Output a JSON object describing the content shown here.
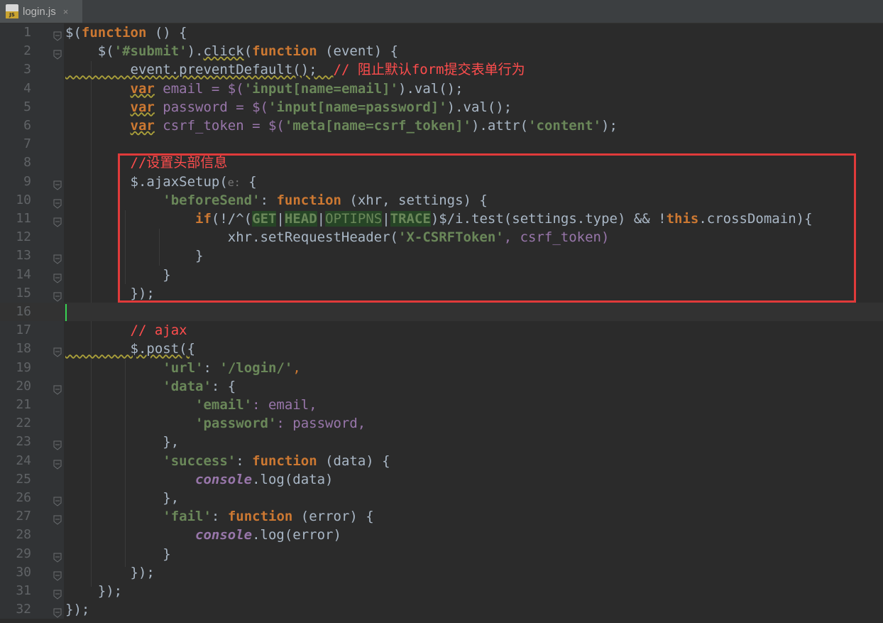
{
  "tab": {
    "filename": "login.js",
    "file_icon": "js-file-icon",
    "close_glyph": "×"
  },
  "line_numbers": [
    "1",
    "2",
    "3",
    "4",
    "5",
    "6",
    "7",
    "8",
    "9",
    "10",
    "11",
    "12",
    "13",
    "14",
    "15",
    "16",
    "17",
    "18",
    "19",
    "20",
    "21",
    "22",
    "23",
    "24",
    "25",
    "26",
    "27",
    "28",
    "29",
    "30",
    "31",
    "32"
  ],
  "lines": {
    "l1": {
      "a": "$(",
      "b": "function",
      "c": " () {"
    },
    "l2": {
      "a": "    $(",
      "b": "'#submit'",
      "c": ").",
      "d": "click",
      "e": "(",
      "f": "function",
      "g": " (event) {"
    },
    "l3": {
      "a": "        event.preventDefault();  ",
      "b": "// 阻止默认form提交表单行为"
    },
    "l4": {
      "a": "        ",
      "b": "var",
      "c": " email = $(",
      "d": "'input[name=email]'",
      "e": ").val();"
    },
    "l5": {
      "a": "        ",
      "b": "var",
      "c": " password = $(",
      "d": "'input[name=password]'",
      "e": ").val();"
    },
    "l6": {
      "a": "        ",
      "b": "var",
      "c": " csrf_token = $(",
      "d": "'meta[name=csrf_token]'",
      "e": ").attr(",
      "f": "'content'",
      "g": ");"
    },
    "l7": {
      "a": ""
    },
    "l8": {
      "a": "        ",
      "b": "//设置头部信息"
    },
    "l9": {
      "a": "        $.ajaxSetup(",
      "b": "e:",
      "c": " {"
    },
    "l10": {
      "a": "            ",
      "b": "'beforeSend'",
      "c": ": ",
      "d": "function",
      "e": " (xhr, settings) {"
    },
    "l11": {
      "a": "                ",
      "b": "if",
      "c": "(!/^(",
      "d": "GET",
      "e": "|",
      "f": "HEAD",
      "g": "|",
      "h": "OPTIPNS",
      "i": "|",
      "j": "TRACE",
      "k": ")$/i.test(settings.type) && !",
      "l": "this",
      "m": ".crossDomain){"
    },
    "l12": {
      "a": "                    xhr.setRequestHeader(",
      "b": "'X-CSRFToken'",
      "c": ", csrf_token)"
    },
    "l13": {
      "a": "                }"
    },
    "l14": {
      "a": "            }"
    },
    "l15": {
      "a": "        });"
    },
    "l16": {
      "a": ""
    },
    "l17": {
      "a": "        ",
      "b": "// ajax"
    },
    "l18": {
      "a": "        $.post({"
    },
    "l19": {
      "a": "            ",
      "b": "'url'",
      "c": ": ",
      "d": "'/login/'",
      "e": ","
    },
    "l20": {
      "a": "            ",
      "b": "'data'",
      "c": ": {"
    },
    "l21": {
      "a": "                ",
      "b": "'email'",
      "c": ": email,"
    },
    "l22": {
      "a": "                ",
      "b": "'password'",
      "c": ": password,"
    },
    "l23": {
      "a": "            },"
    },
    "l24": {
      "a": "            ",
      "b": "'success'",
      "c": ": ",
      "d": "function",
      "e": " (data) {"
    },
    "l25": {
      "a": "                ",
      "b": "console",
      "c": ".log(data)"
    },
    "l26": {
      "a": "            },"
    },
    "l27": {
      "a": "            ",
      "b": "'fail'",
      "c": ": ",
      "d": "function",
      "e": " (error) {"
    },
    "l28": {
      "a": "                ",
      "b": "console",
      "c": ".log(error)"
    },
    "l29": {
      "a": "            }"
    },
    "l30": {
      "a": "        });"
    },
    "l31": {
      "a": "    });"
    },
    "l32": {
      "a": "});"
    }
  },
  "colors": {
    "background": "#2b2b2b",
    "gutter": "#313335",
    "keyword": "#cc7832",
    "string": "#6a8759",
    "comment": "#ff4d4d",
    "highlight_box": "#e03a3a",
    "caret": "#39d353"
  }
}
